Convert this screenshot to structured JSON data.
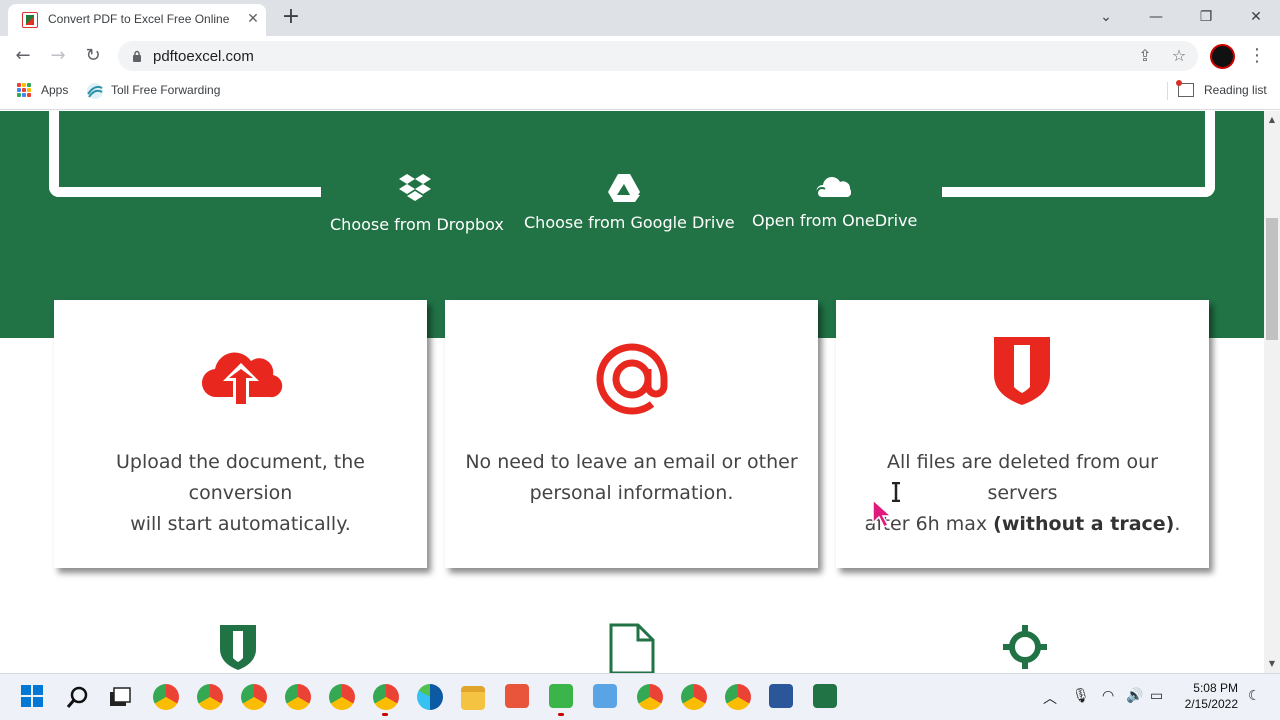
{
  "browser": {
    "tab_title": "Convert PDF to Excel Free Online - N",
    "tab_close": "✕",
    "new_tab": "+",
    "url": "pdftoexcel.com",
    "window_controls": {
      "minimize": "—",
      "restore": "❐",
      "close": "✕"
    },
    "tab_search": "⌄"
  },
  "bookmarks": {
    "apps": "Apps",
    "toll_free": "Toll Free Forwarding",
    "reading_list": "Reading list"
  },
  "cloud_options": [
    {
      "label": "Choose from Dropbox",
      "icon": "dropbox-icon"
    },
    {
      "label": "Choose from Google Drive",
      "icon": "google-drive-icon"
    },
    {
      "label": "Open from OneDrive",
      "icon": "onedrive-icon"
    }
  ],
  "features": [
    {
      "icon": "cloud-upload-icon",
      "text_line1": "Upload the document, the conversion",
      "text_line2": "will start automatically."
    },
    {
      "icon": "at-sign-icon",
      "text_line1": "No need to leave an email or other",
      "text_line2": "personal information."
    },
    {
      "icon": "shield-icon",
      "text_line1": "All files are deleted from our servers",
      "text_line2_plain": "after 6h max ",
      "text_line2_bold": "(without a trace)",
      "text_line2_end": "."
    }
  ],
  "colors": {
    "brand_green": "#217346",
    "accent_red": "#e8281e"
  },
  "taskbar": {
    "time": "5:08 PM",
    "date": "2/15/2022"
  }
}
